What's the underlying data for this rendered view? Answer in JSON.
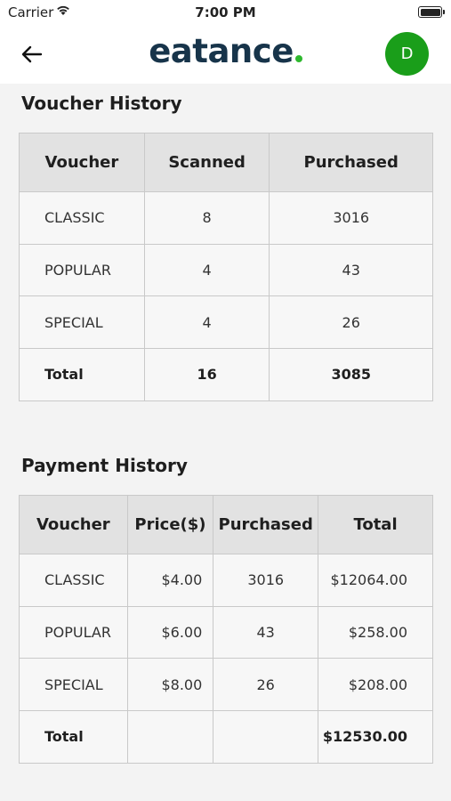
{
  "status_bar": {
    "carrier": "Carrier",
    "time": "7:00 PM"
  },
  "header": {
    "logo_text": "eatance",
    "avatar_initial": "D",
    "logo_color": "#17344a",
    "accent_color": "#2eb82e"
  },
  "voucher_history": {
    "title": "Voucher History",
    "columns": [
      "Voucher",
      "Scanned",
      "Purchased"
    ],
    "rows": [
      {
        "voucher": "CLASSIC",
        "scanned": "8",
        "purchased": "3016"
      },
      {
        "voucher": "POPULAR",
        "scanned": "4",
        "purchased": "43"
      },
      {
        "voucher": "SPECIAL",
        "scanned": "4",
        "purchased": "26"
      }
    ],
    "total": {
      "label": "Total",
      "scanned": "16",
      "purchased": "3085"
    }
  },
  "payment_history": {
    "title": "Payment History",
    "columns": [
      "Voucher",
      "Price($)",
      "Purchased",
      "Total"
    ],
    "rows": [
      {
        "voucher": "CLASSIC",
        "price": "$4.00",
        "purchased": "3016",
        "total": "$12064.00"
      },
      {
        "voucher": "POPULAR",
        "price": "$6.00",
        "purchased": "43",
        "total": "$258.00"
      },
      {
        "voucher": "SPECIAL",
        "price": "$8.00",
        "purchased": "26",
        "total": "$208.00"
      }
    ],
    "total": {
      "label": "Total",
      "price": "",
      "purchased": "",
      "total": "$12530.00"
    }
  }
}
